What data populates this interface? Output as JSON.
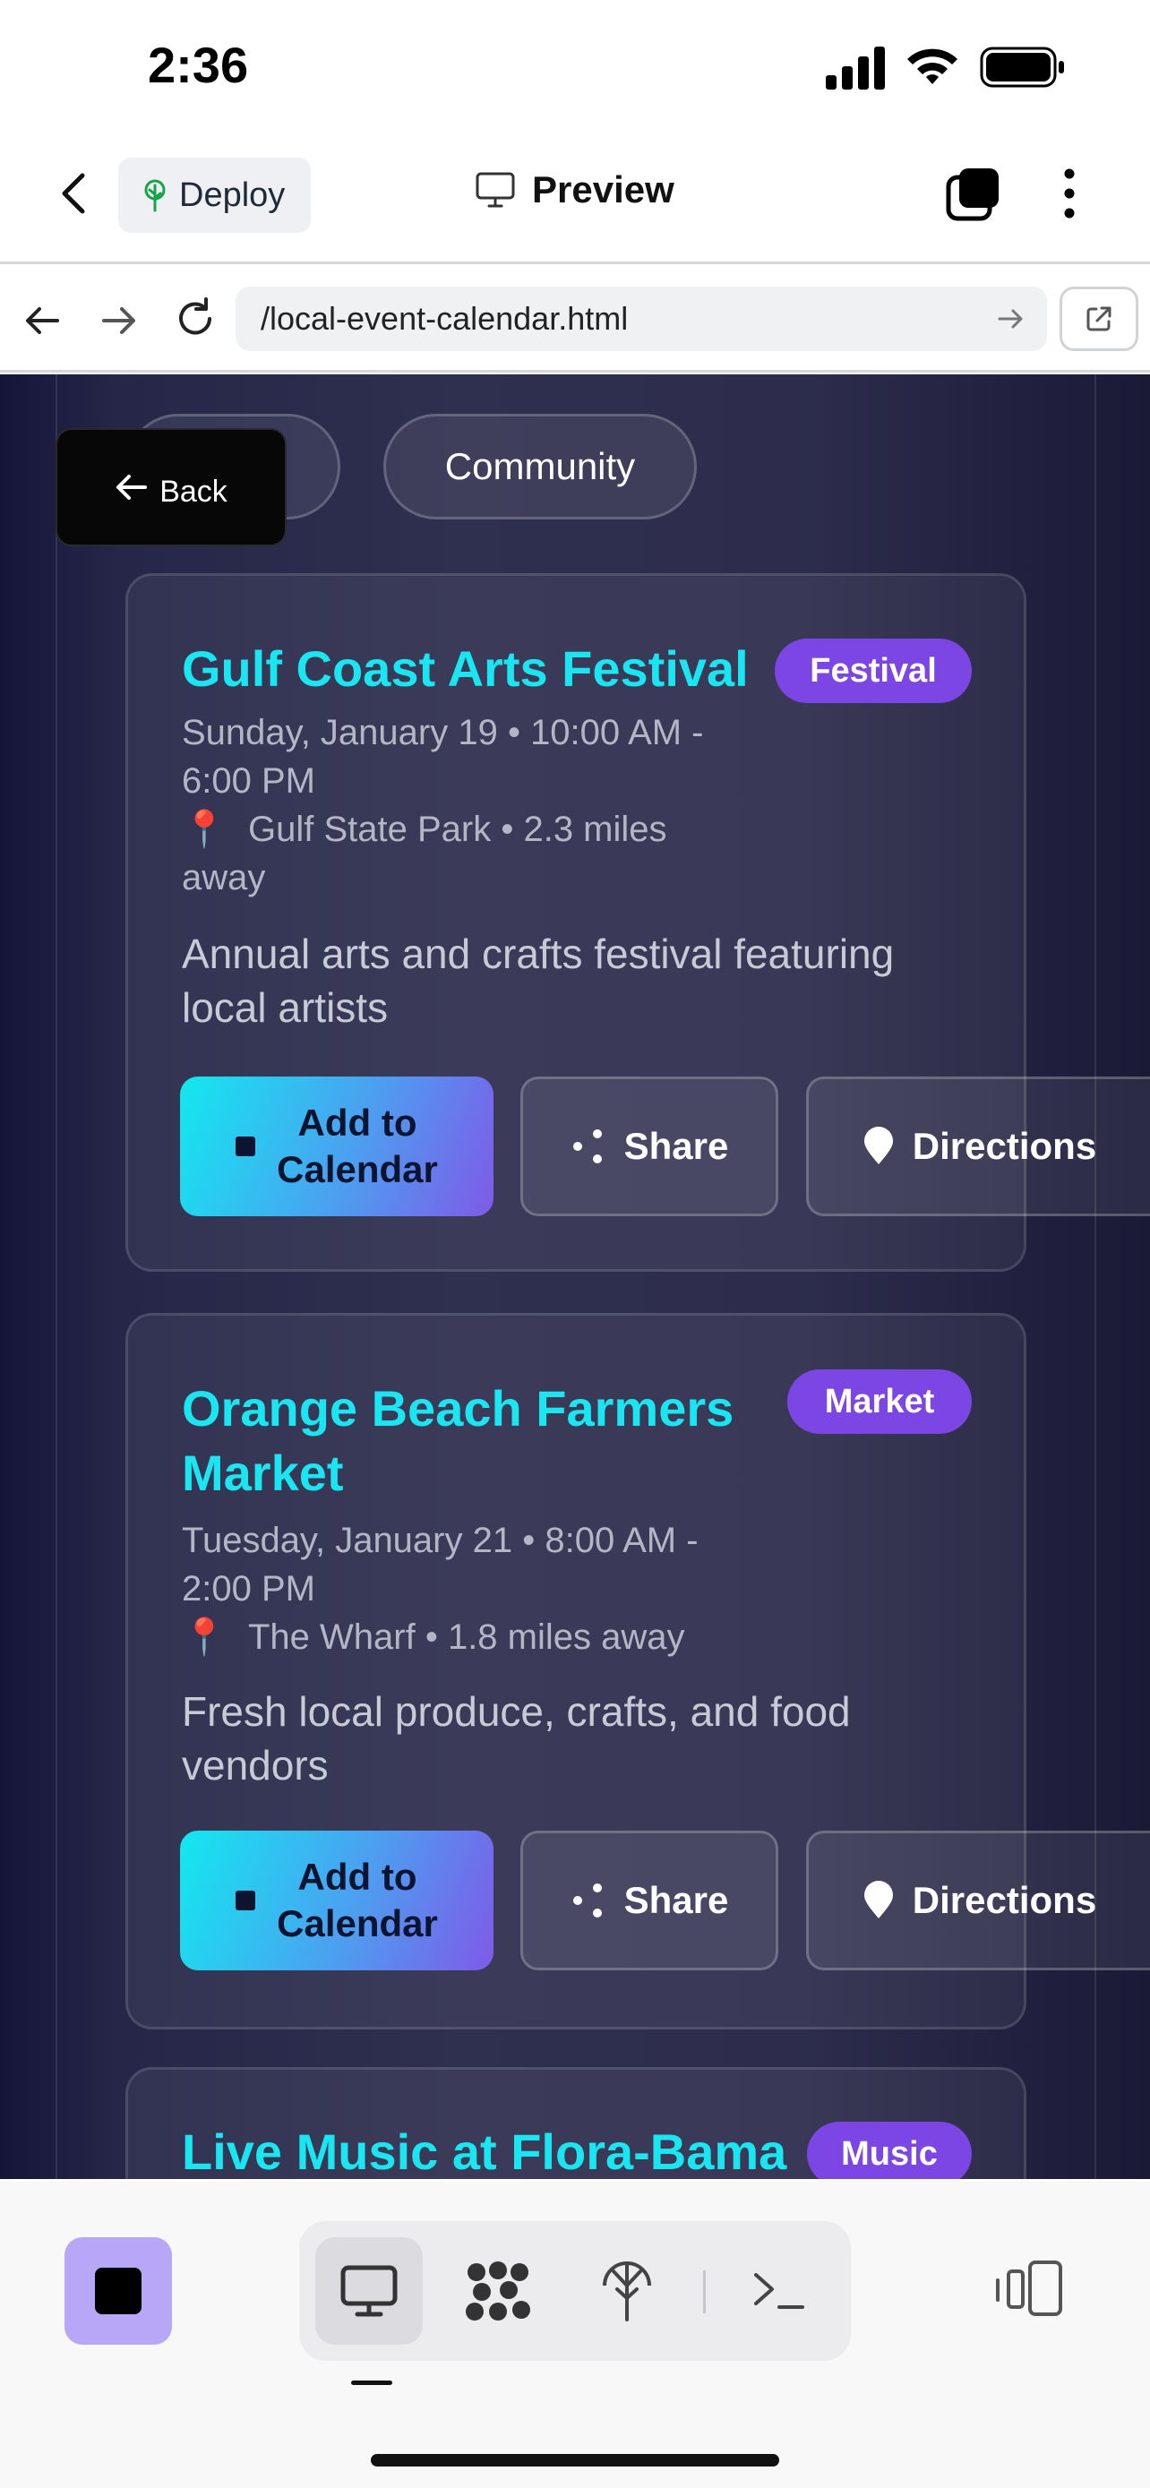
{
  "status_bar": {
    "time": "2:36"
  },
  "header": {
    "deploy_label": "Deploy",
    "title": "Preview"
  },
  "browser": {
    "url": "/local-event-calendar.html"
  },
  "page": {
    "back_label": "Back",
    "filters": [
      "Community"
    ],
    "events": [
      {
        "title": "Gulf Coast Arts Festival",
        "badge": "Festival",
        "when_line1": "Sunday, January 19 • 10:00 AM -",
        "when_line2": "6:00 PM",
        "where_line1": "Gulf State Park • 2.3 miles",
        "where_line2": "away",
        "desc_line1": "Annual arts and crafts festival featuring",
        "desc_line2": "local artists"
      },
      {
        "title_line1": "Orange Beach Farmers",
        "title_line2": "Market",
        "badge": "Market",
        "when_line1": "Tuesday, January 21 • 8:00 AM -",
        "when_line2": "2:00 PM",
        "where_line1": "The Wharf • 1.8 miles away",
        "desc_line1": "Fresh local produce, crafts, and food",
        "desc_line2": "vendors"
      },
      {
        "title": "Live Music at Flora-Bama",
        "badge": "Music"
      }
    ],
    "actions": {
      "add_line1": "Add to",
      "add_line2": "Calendar",
      "share": "Share",
      "directions": "Directions"
    }
  },
  "colors": {
    "title_cyan": "#19e6f0",
    "badge_purple": "#7b46e3",
    "stop_button": "#b8a7f7"
  },
  "icons": [
    "chevron-left-icon",
    "deploy-tree-icon",
    "monitor-icon",
    "tabs-icon",
    "more-vertical-icon",
    "arrow-left-icon",
    "arrow-right-icon",
    "reload-icon",
    "external-link-icon",
    "stop-icon",
    "code-grid-icon",
    "deploy-icon",
    "terminal-icon",
    "device-switch-icon",
    "pin-icon",
    "share-icon",
    "location-icon",
    "calendar-icon"
  ]
}
